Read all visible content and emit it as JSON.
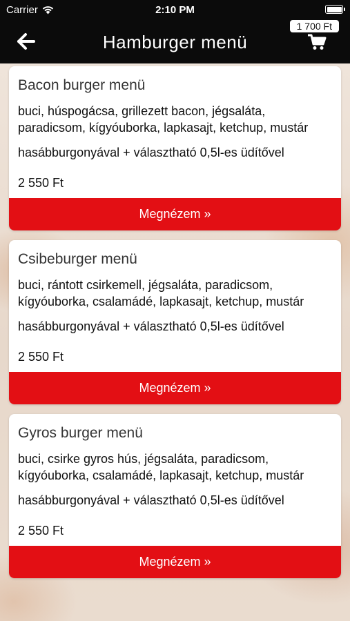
{
  "status": {
    "carrier": "Carrier",
    "time": "2:10 PM"
  },
  "header": {
    "title": "Hamburger menü",
    "cart_total": "1 700 Ft"
  },
  "items": [
    {
      "name": "Bacon burger menü",
      "description": "buci, húspogácsa, grillezett bacon, jégsaláta, paradicsom, kígyóuborka, lapkasajt, ketchup, mustár",
      "extra": "hasábburgonyával + választható 0,5l-es üdítővel",
      "price": "2 550 Ft",
      "button": "Megnézem »"
    },
    {
      "name": "Csibeburger menü",
      "description": "buci, rántott csirkemell, jégsaláta, paradicsom, kígyóuborka, csalamádé, lapkasajt, ketchup, mustár",
      "extra": "hasábburgonyával + választható 0,5l-es üdítővel",
      "price": "2 550 Ft",
      "button": "Megnézem »"
    },
    {
      "name": "Gyros burger menü",
      "description": "buci, csirke gyros hús, jégsaláta, paradicsom, kígyóuborka, csalamádé, lapkasajt, ketchup, mustár",
      "extra": "hasábburgonyával + választható 0,5l-es üdítővel",
      "price": "2 550 Ft",
      "button": "Megnézem »"
    }
  ],
  "colors": {
    "accent": "#e30f14",
    "topbar": "#0b0b0b"
  },
  "icons": {
    "back": "arrow-left-icon",
    "cart": "shopping-cart-icon",
    "wifi": "wifi-icon",
    "battery": "battery-icon"
  }
}
